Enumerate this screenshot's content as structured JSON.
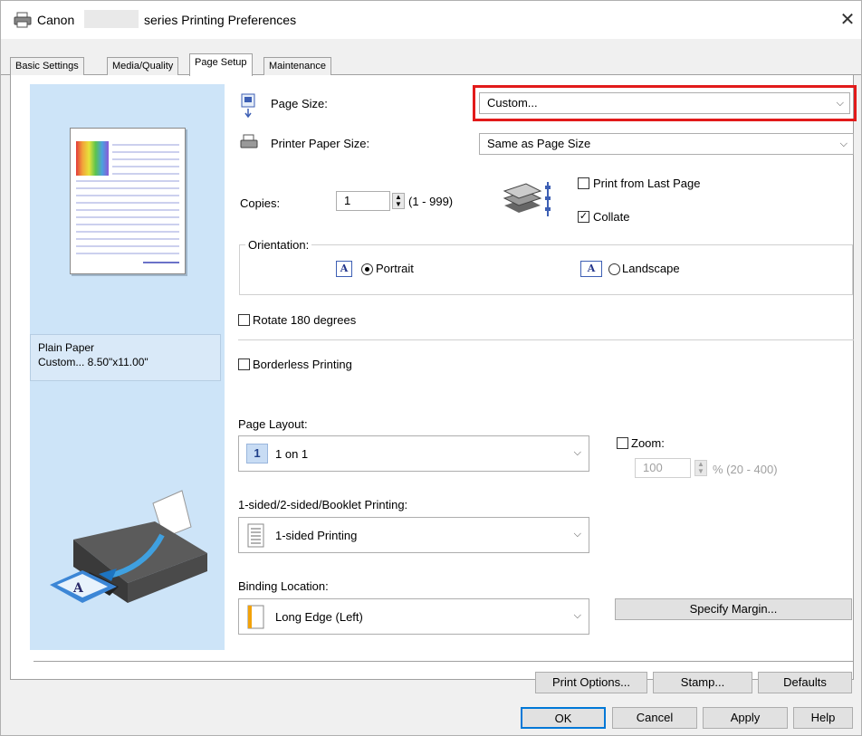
{
  "window": {
    "title_prefix": "Canon",
    "title_suffix": "series Printing Preferences",
    "close": "✕"
  },
  "tabs": [
    {
      "label": "Basic Settings"
    },
    {
      "label": "Media/Quality"
    },
    {
      "label": "Page Setup"
    },
    {
      "label": "Maintenance"
    }
  ],
  "preview": {
    "media_type": "Plain Paper",
    "media_size": "Custom... 8.50\"x11.00\""
  },
  "page_size": {
    "label": "Page Size:",
    "value": "Custom..."
  },
  "printer_paper_size": {
    "label": "Printer Paper Size:",
    "value": "Same as Page Size"
  },
  "copies": {
    "label": "Copies:",
    "value": "1",
    "range": "(1 - 999)"
  },
  "print_from_last_page": {
    "label": "Print from Last Page",
    "checked": false
  },
  "collate": {
    "label": "Collate",
    "checked": true,
    "mark": "✓"
  },
  "orientation": {
    "label": "Orientation:",
    "portrait": "Portrait",
    "landscape": "Landscape",
    "icon_letter": "A"
  },
  "rotate_180": {
    "label": "Rotate 180 degrees"
  },
  "borderless": {
    "label": "Borderless Printing"
  },
  "page_layout": {
    "label": "Page Layout:",
    "value": "1 on 1",
    "icon_number": "1"
  },
  "zoom": {
    "label": "Zoom:",
    "value": "100",
    "range": "% (20 - 400)"
  },
  "duplex": {
    "label": "1-sided/2-sided/Booklet Printing:",
    "value": "1-sided Printing"
  },
  "binding": {
    "label": "Binding Location:",
    "value": "Long Edge (Left)"
  },
  "buttons": {
    "specify_margin": "Specify Margin...",
    "print_options": "Print Options...",
    "stamp": "Stamp...",
    "defaults": "Defaults",
    "ok": "OK",
    "cancel": "Cancel",
    "apply": "Apply",
    "help": "Help"
  },
  "colors": {
    "highlight": "#e21a1a",
    "preview_bg": "#cde4f8",
    "accent": "#3d5fb4"
  }
}
